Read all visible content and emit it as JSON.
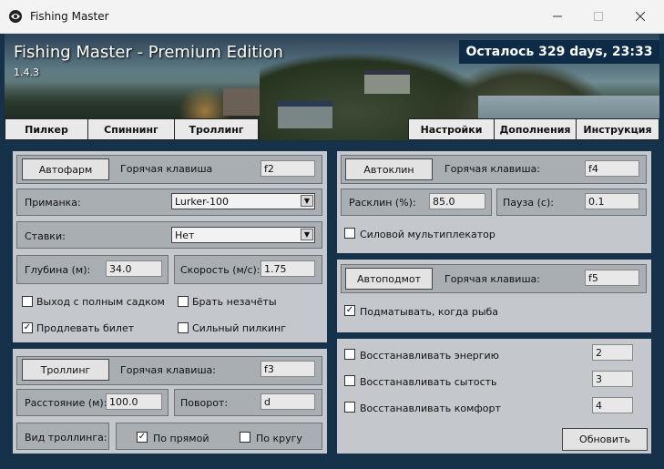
{
  "window": {
    "title": "Fishing Master"
  },
  "header": {
    "title": "Fishing Master - Premium Edition",
    "version": "1.4.3",
    "timer": "Осталось 329 days, 23:33"
  },
  "tabs_left": [
    "Пилкер",
    "Спиннинг",
    "Троллинг"
  ],
  "tabs_right": [
    "Настройки",
    "Дополнения",
    "Инструкция"
  ],
  "autofarm": {
    "button": "Автофарм",
    "hotkey_label": "Горячая клавиша",
    "hotkey_value": "f2",
    "bait_label": "Приманка:",
    "bait_value": "Lurker-100",
    "bets_label": "Ставки:",
    "bets_value": "Нет",
    "depth_label": "Глубина (м):",
    "depth_value": "34.0",
    "speed_label": "Скорость (м/с):",
    "speed_value": "1.75",
    "exit_full_label": "Выход с полным садком",
    "exit_full_checked": false,
    "take_unrec_label": "Брать незачёты",
    "take_unrec_checked": false,
    "extend_ticket_label": "Продлевать билет",
    "extend_ticket_checked": true,
    "strong_pilk_label": "Сильный пилкинг",
    "strong_pilk_checked": false
  },
  "trolling": {
    "button": "Троллинг",
    "hotkey_label": "Горячая клавиша:",
    "hotkey_value": "f3",
    "distance_label": "Расстояние (м):",
    "distance_value": "100.0",
    "turn_label": "Поворот:",
    "turn_value": "d",
    "type_label": "Вид троллинга:",
    "straight_label": "По прямой",
    "straight_checked": true,
    "circle_label": "По кругу",
    "circle_checked": false
  },
  "autoclean": {
    "button": "Автоклин",
    "hotkey_label": "Горячая клавиша:",
    "hotkey_value": "f4",
    "clean_label": "Расклин (%):",
    "clean_value": "85.0",
    "pause_label": "Пауза (с):",
    "pause_value": "0.1",
    "multiplier_label": "Силовой мультиплекатор",
    "multiplier_checked": false
  },
  "autohook": {
    "button": "Автоподмот",
    "hotkey_label": "Горячая клавиша:",
    "hotkey_value": "f5",
    "reel_label": "Подматывать, когда рыба",
    "reel_checked": true
  },
  "restore": {
    "energy_label": "Восстанавливать энергию",
    "energy_value": "2",
    "energy_checked": false,
    "satiety_label": "Восстанавливать сытость",
    "satiety_value": "3",
    "satiety_checked": false,
    "comfort_label": "Восстанавливать комфорт",
    "comfort_value": "4",
    "comfort_checked": false,
    "update_button": "Обновить"
  },
  "colors": {
    "panel": "#c4c8cc",
    "frame": "#a9aeb3",
    "background": "#15324a",
    "timer_bg": "#0d2a47"
  }
}
